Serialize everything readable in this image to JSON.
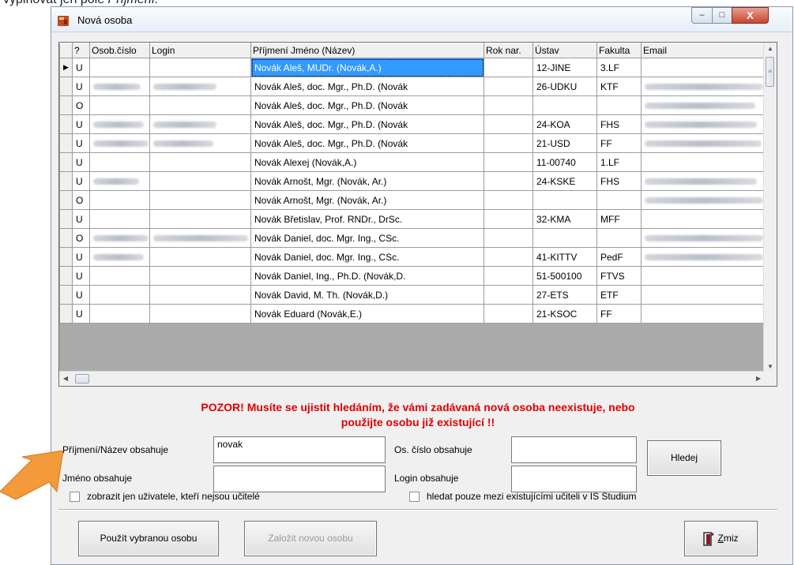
{
  "doc": {
    "prefix": "vyplňovat jen pole ",
    "italic": "Příjmení."
  },
  "window": {
    "title": "Nová osoba",
    "min": "–",
    "max": "□",
    "close": "X"
  },
  "grid": {
    "columns": [
      "?",
      "Osob.číslo",
      "Login",
      "Příjmení Jméno (Název)",
      "Rok nar.",
      "Ústav",
      "Fakulta",
      "Email"
    ],
    "rows": [
      {
        "type": "U",
        "name": "Novák Aleš, MUDr. (Novák,A.)",
        "ustav": "12-JINE",
        "fakulta": "3.LF"
      },
      {
        "type": "U",
        "name": "Novák Aleš, doc. Mgr., Ph.D. (Novák",
        "ustav": "26-UDKU",
        "fakulta": "KTF"
      },
      {
        "type": "O",
        "name": "Novák Aleš, doc. Mgr., Ph.D. (Novák",
        "ustav": "",
        "fakulta": ""
      },
      {
        "type": "U",
        "name": "Novák Aleš, doc. Mgr., Ph.D. (Novák",
        "ustav": "24-KOA",
        "fakulta": "FHS"
      },
      {
        "type": "U",
        "name": "Novák Aleš, doc. Mgr., Ph.D. (Novák",
        "ustav": "21-USD",
        "fakulta": "FF"
      },
      {
        "type": "U",
        "name": "Novák Alexej (Novák,A.)",
        "ustav": "11-00740",
        "fakulta": "1.LF"
      },
      {
        "type": "U",
        "name": "Novák Arnošt, Mgr. (Novák, Ar.)",
        "ustav": "24-KSKE",
        "fakulta": "FHS"
      },
      {
        "type": "O",
        "name": "Novák Arnošt, Mgr. (Novák, Ar.)",
        "ustav": "",
        "fakulta": ""
      },
      {
        "type": "U",
        "name": "Novák Břetislav, Prof. RNDr., DrSc.",
        "ustav": "32-KMA",
        "fakulta": "MFF"
      },
      {
        "type": "O",
        "name": "Novák Daniel, doc. Mgr. Ing., CSc.",
        "ustav": "",
        "fakulta": ""
      },
      {
        "type": "U",
        "name": "Novák Daniel, doc. Mgr. Ing., CSc.",
        "ustav": "41-KITTV",
        "fakulta": "PedF"
      },
      {
        "type": "U",
        "name": "Novák Daniel, Ing., Ph.D. (Novák,D.",
        "ustav": "51-500100",
        "fakulta": "FTVS"
      },
      {
        "type": "U",
        "name": "Novák David, M. Th. (Novák,D.)",
        "ustav": "27-ETS",
        "fakulta": "ETF"
      },
      {
        "type": "U",
        "name": "Novák Eduard (Novák,E.)",
        "ustav": "21-KSOC",
        "fakulta": "FF"
      }
    ]
  },
  "warning": {
    "line1": "POZOR! Musíte se ujistit hledáním, že vámi zadávaná nová osoba neexistuje, nebo",
    "line2": "použijte osobu již existující !!"
  },
  "form": {
    "surname_label": "Příjmení/Název obsahuje",
    "surname_value": "novak",
    "name_label": "Jméno obsahuje",
    "name_value": "",
    "osc_label": "Os. číslo obsahuje",
    "osc_value": "",
    "login_label": "Login obsahuje",
    "login_value": "",
    "search_button": "Hledej",
    "chk_nonteachers": "zobrazit jen uživatele, kteří nejsou učitelé",
    "chk_teachers": "hledat pouze mezi existujícími učiteli v IS Studium"
  },
  "buttons": {
    "use": "Použít vybranou osobu",
    "create": "Založit novou osobu",
    "vanish": "Zmiz",
    "vanish_key": "Z"
  },
  "colors": {
    "warning": "#e00000",
    "selection": "#3399ff",
    "arrow": "#f39a3a"
  }
}
